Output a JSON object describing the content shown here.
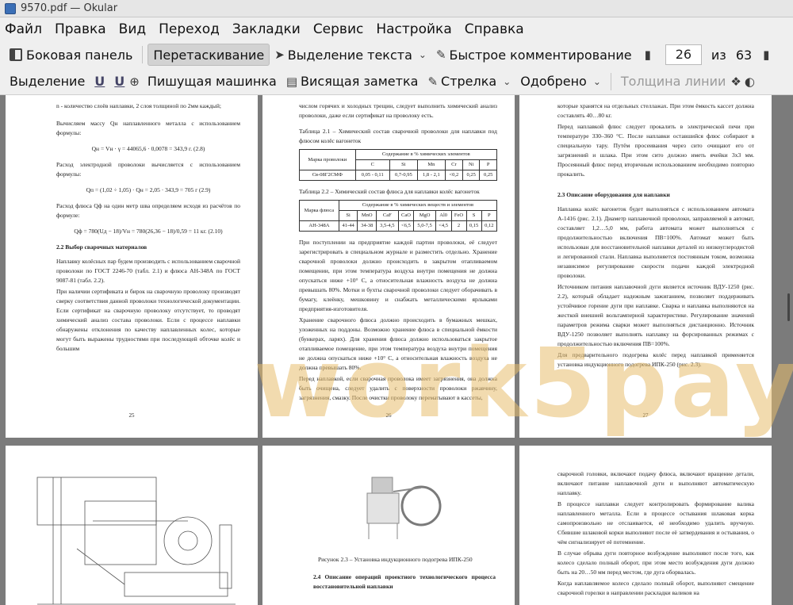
{
  "window": {
    "title": "9570.pdf — Okular"
  },
  "menu": [
    "Файл",
    "Правка",
    "Вид",
    "Переход",
    "Закладки",
    "Сервис",
    "Настройка",
    "Справка"
  ],
  "toolbar1": {
    "side_panel": "Боковая панель",
    "drag": "Перетаскивание",
    "text_select": "Выделение текста",
    "quick_comment": "Быстрое комментирование",
    "page_current": "26",
    "page_of": "из",
    "page_total": "63"
  },
  "toolbar2": {
    "select": "Выделение",
    "typewriter": "Пишущая машинка",
    "sticky_note": "Висящая заметка",
    "arrow": "Стрелка",
    "approved": "Одобрено",
    "line_width": "Толщина линии"
  },
  "watermark": "work5pay.ru",
  "pages": {
    "p25": {
      "lines": [
        "n - количество слоёв наплавки, 2 слоя толщиной по 2мм каждый;",
        "Вычисляем массу Qн наплавленного металла с использованием формулы:",
        "Qн = Vн · γ = 44065,6 · 0,0078 = 343,9 г.   (2.8)",
        "Расход электродной проволоки вычисляется с использованием формулы:",
        "Qп = (1,02 ÷ 1,05) · Qн = 2,05 · 343,9 = 705 г   (2.9)",
        "Расход флюса Qф на один метр шва определяем исходя из расчётов по формуле:",
        "Qф = 780(Uд − 18)/Vн = 780(26,36 − 18)/0,59 = 11 кг.   (2.10)"
      ],
      "heading": "2.2 Выбор сварочных материалов",
      "body": [
        "Наплавку колёсных пар будем производить с использованием сварочной проволоки по ГОСТ 2246-70 (табл. 2.1) и флюса АН-348А по ГОСТ 9087-81 (табл. 2.2).",
        "При наличии сертификата и бирок на сварочную проволоку производят сверку соответствия данной проволоки технологической документации. Если сертификат на сварочную проволоку отсутствует, то проводят химический анализ состава проволоки. Если с процессе наплавки обнаружены отклонения по качеству наплавленных колес, которые могут быть выражены трудностями при последующей обточке колёс и большим"
      ],
      "number": "25"
    },
    "p26": {
      "top": "числом горячих и холодных трещин, следует выполнить химический анализ проволоки, даже если сертификат на проволоку есть.",
      "t1_caption": "Таблица 2.1 – Химический состав сварочной проволоки для наплавки под флюсом колёс вагонеток",
      "t1_head": [
        "Марка проволоки",
        "Содержание в % химических элементов"
      ],
      "t1_cols": [
        "C",
        "Si",
        "Mn",
        "Cr",
        "Ni",
        "P"
      ],
      "t1_row": [
        "Св-08Г2СМФ",
        "0,05 - 0,11",
        "0,7-0,95",
        "1,8 - 2,1",
        "<0,2",
        "0,25",
        "0,25"
      ],
      "t2_caption": "Таблица 2.2 – Химический состав флюса для наплавки колёс вагонеток",
      "t2_head": [
        "Марка флюса",
        "Содержание в % химических веществ и элементов"
      ],
      "t2_cols": [
        "Si",
        "MnO",
        "CaF",
        "CaO",
        "MgO",
        "Al0",
        "FeO",
        "S",
        "P"
      ],
      "t2_row": [
        "АН-348А",
        "41-44",
        "34-38",
        "3,5-4,5",
        "<6,5",
        "5,0-7,5",
        "<4,5",
        "2",
        "0,15",
        "0,12"
      ],
      "body": [
        "При поступлении на предприятие каждой партии проволоки, её следует зарегистрировать в специальном журнале и разместить отдельно. Хранение сварочной проволоки должно происходить в закрытом отапливаемом помещении, при этом температура воздуха внутри помещения не должна опускаться ниже +10° С, а относительная влажность воздуха не должна превышать 80%. Мотки и бухты сварочной проволоки следует оборачивать в бумагу, клеёнку, мешковину и снабжать металлическими ярлыками предприятия-изготовителя.",
        "Хранение сварочного флюса должно происходить в бумажных мешках, уложенных на поддоны. Возможно хранение флюса в специальной ёмкости (бункерах, ларях). Для хранения флюса должно использоваться закрытое отапливаемое помещение, при этом температура воздуха внутри помещения не должна опускаться ниже +10° С, а относительная влажность воздуха не должна превышать 80%.",
        "Перед наплавкой, если сварочная проволока имеет загрязнения, она должна быть очищена, следует удалить с поверхности проволоки ржавчину, загрязнения, смазку. После очистки проволоку перематывают в кассеты,"
      ],
      "number": "26"
    },
    "p27": {
      "body": [
        "которые хранятся на отдельных стеллажах. При этом ёмкость кассет должна составлять 40…80 кг.",
        "Перед наплавкой флюс следует прокалить в электрической печи при температуре 330–360 °С. После наплавки оставшийся флюс собирают в специальную тару. Путём просеивания через сито очищают его от загрязнений и шлака. При этом сито должно иметь ячейки 3х3 мм. Просеянный флюс перед вторичным использованием необходимо повторно прокалить."
      ],
      "heading": "2.3 Описание оборудования для наплавки",
      "body2": [
        "Наплавка колёс вагонеток будет выполняться с использованием автомата А-1416 (рис. 2.1). Диаметр наплавочной проволоки, заправляемой в автомат, составляет 1,2…5,0 мм, работа автомата может выполняться с продолжительностью включения ПВ=100%. Автомат может быть использован для восстановительной наплавки деталей из низкоуглеродистой и легированной стали. Наплавка выполняется постоянным током, возможна незавиcимое регулирование скорости подачи каждой электродной проволоки.",
        "Источником питания наплавочной дуги является источник ВДУ-1250 (рис. 2.2), который обладает надежным зажиганием, позволяет поддерживать устойчивое горение дуги при наплавке. Сварка и наплавка выполняются на жесткой внешней вольтамперной характеристике. Регулирование значений параметров режима сварки может выполняться дистанционно. Источник ВДУ-1250 позволяет выполнять наплавку на форсированных режимах с продолжительностью включения ПВ=100%.",
        "Для предварительного подогрева колёс перед наплавкой применяется установка индукционного подогрева ИПК-250 (рис. 2.3)."
      ],
      "number": "27"
    },
    "p29": {
      "caption": "Рисунок 2.3 – Установка индукционного подогрева ИПК-250",
      "heading": "2.4 Описание операций проектного технологического процесса восстановительной наплавки"
    },
    "p30": {
      "body": [
        "сварочной головки, включают подачу флюса, включают вращение детали, включают питание наплавочной дуги и выполняют автоматическую наплавку.",
        "В процессе наплавки следует контролировать формирование валика наплавленного металла. Если в процессе остывания шлаковая корка самопроизвольно не отслаивается, её необходимо удалить вручную. Сбившие шлаковой корки выполняют после её затвердевания и остывания, о чём сигнализирует её потемнение.",
        "В случае обрыва дуги повторное возбуждение выполняют после того, как колесо сделало полный оборот, при этом место возбуждения дуги должно быть на 20…50 мм перед местом, где дуга оборвалась.",
        "Когда наплавляемое колесо сделало полный оборот, выполняют смещение сварочной горелки в направлении раскладки валиков на"
      ]
    }
  }
}
